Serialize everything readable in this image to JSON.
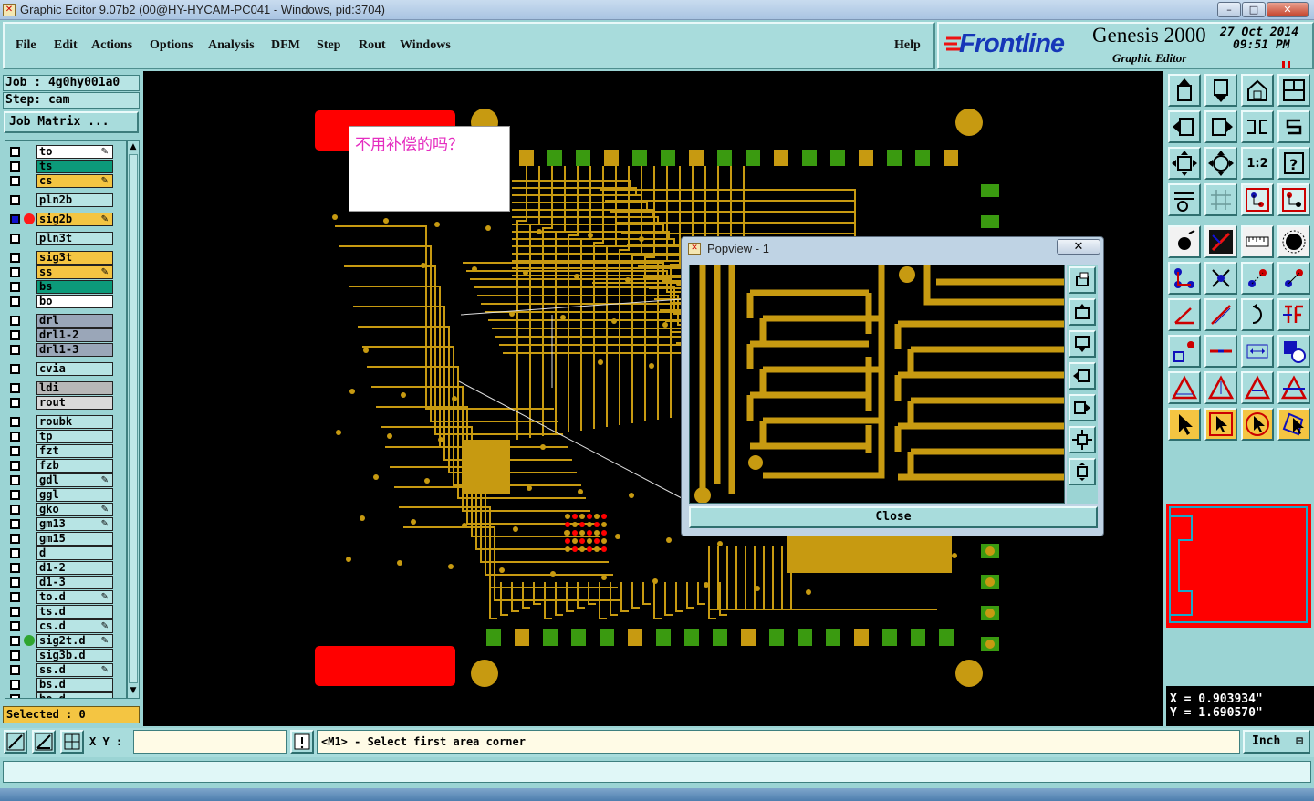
{
  "window": {
    "title": "Graphic Editor 9.07b2 (00@HY-HYCAM-PC041 - Windows, pid:3704)",
    "minimize": "–",
    "maximize": "□",
    "close": "✕"
  },
  "menu": {
    "items": [
      "File",
      "Edit",
      "Actions",
      "Options",
      "Analysis",
      "DFM",
      "Step",
      "Rout",
      "Windows"
    ],
    "help": "Help"
  },
  "brand": {
    "logo": "Frontline",
    "product": "Genesis 2000",
    "subtitle": "Graphic Editor",
    "date": "27 Oct 2014",
    "time": "09:51 PM"
  },
  "job": {
    "job_line": "Job : 4g0hy001a0",
    "step_line": "Step: cam",
    "matrix_button": "Job Matrix ..."
  },
  "layers": [
    {
      "name": "to",
      "color": "#ffffff",
      "mark": "✎"
    },
    {
      "name": "ts",
      "color": "#0c9a7a",
      "mark": ""
    },
    {
      "name": "cs",
      "color": "#f4c542",
      "mark": "✎"
    },
    {
      "name": "pln2b",
      "color": "#b7e4e4",
      "mark": ""
    },
    {
      "name": "sig2b",
      "color": "#f4c542",
      "mark": "✎"
    },
    {
      "name": "pln3t",
      "color": "#b7e4e4",
      "mark": ""
    },
    {
      "name": "sig3t",
      "color": "#f4c542",
      "mark": ""
    },
    {
      "name": "ss",
      "color": "#f4c542",
      "mark": "✎"
    },
    {
      "name": "bs",
      "color": "#0c9a7a",
      "mark": ""
    },
    {
      "name": "bo",
      "color": "#ffffff",
      "mark": ""
    },
    {
      "name": "drl",
      "color": "#9aa6b8",
      "mark": ""
    },
    {
      "name": "drl1-2",
      "color": "#9aa6b8",
      "mark": ""
    },
    {
      "name": "drl1-3",
      "color": "#9aa6b8",
      "mark": ""
    },
    {
      "name": "cvia",
      "color": "#b7e4e4",
      "mark": ""
    },
    {
      "name": "ldi",
      "color": "#b7b7b7",
      "mark": ""
    },
    {
      "name": "rout",
      "color": "#d9d9d9",
      "mark": ""
    },
    {
      "name": "roubk",
      "color": "#b7e4e4",
      "mark": ""
    },
    {
      "name": "tp",
      "color": "#b7e4e4",
      "mark": ""
    },
    {
      "name": "fzt",
      "color": "#b7e4e4",
      "mark": ""
    },
    {
      "name": "fzb",
      "color": "#b7e4e4",
      "mark": ""
    },
    {
      "name": "gdl",
      "color": "#b7e4e4",
      "mark": "✎"
    },
    {
      "name": "ggl",
      "color": "#b7e4e4",
      "mark": ""
    },
    {
      "name": "gko",
      "color": "#b7e4e4",
      "mark": "✎"
    },
    {
      "name": "gm13",
      "color": "#b7e4e4",
      "mark": "✎"
    },
    {
      "name": "gm15",
      "color": "#b7e4e4",
      "mark": ""
    },
    {
      "name": "d",
      "color": "#b7e4e4",
      "mark": ""
    },
    {
      "name": "d1-2",
      "color": "#b7e4e4",
      "mark": ""
    },
    {
      "name": "d1-3",
      "color": "#b7e4e4",
      "mark": ""
    },
    {
      "name": "to.d",
      "color": "#b7e4e4",
      "mark": "✎"
    },
    {
      "name": "ts.d",
      "color": "#b7e4e4",
      "mark": ""
    },
    {
      "name": "cs.d",
      "color": "#b7e4e4",
      "mark": "✎"
    },
    {
      "name": "sig2t.d",
      "color": "#b7e4e4",
      "mark": "✎"
    },
    {
      "name": "sig3b.d",
      "color": "#b7e4e4",
      "mark": ""
    },
    {
      "name": "ss.d",
      "color": "#b7e4e4",
      "mark": "✎"
    },
    {
      "name": "bs.d",
      "color": "#b7e4e4",
      "mark": ""
    },
    {
      "name": "bo.d",
      "color": "#b7e4e4",
      "mark": ""
    }
  ],
  "selected": "Selected : 0",
  "note": {
    "text": "不用补偿的吗？"
  },
  "popview": {
    "title": "Popview - 1",
    "close_label": "Close"
  },
  "coords": {
    "x": "X = 0.903934\"",
    "y": "Y = 1.690570\""
  },
  "bottom": {
    "xy_label": "X Y :",
    "xy_value": "",
    "prompt": "<M1> - Select first area corner",
    "unit": "Inch"
  },
  "colors": {
    "copper": "#c79a11",
    "pad_green": "#3a9a10",
    "red": "#ff0000",
    "ui_teal": "#a8dcdc"
  }
}
